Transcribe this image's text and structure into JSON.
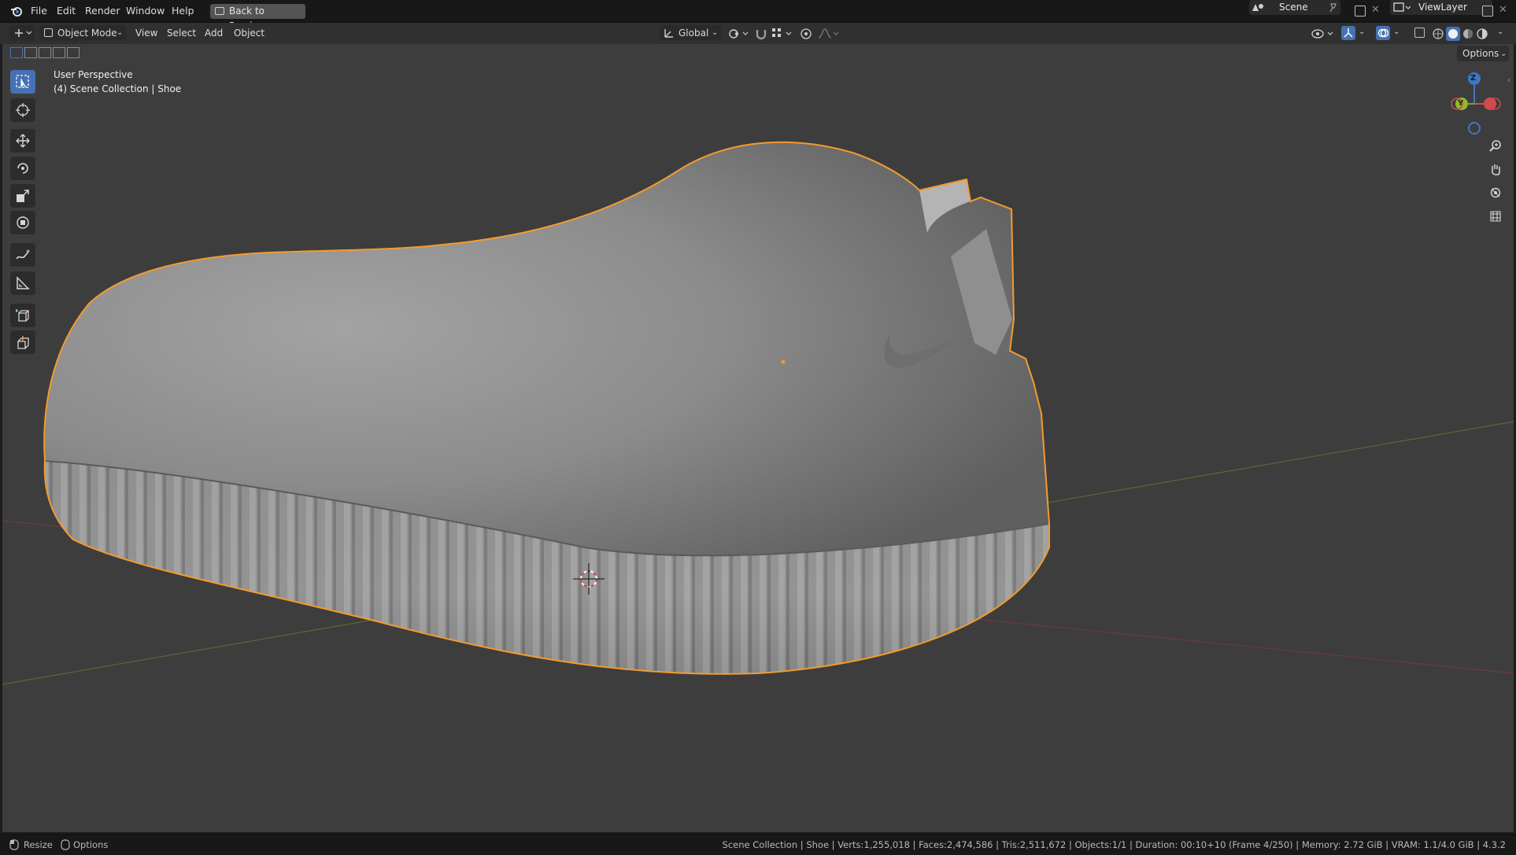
{
  "topbar": {
    "menu": [
      "File",
      "Edit",
      "Render",
      "Window",
      "Help"
    ],
    "back_button": "Back to Previous",
    "scene_name": "Scene",
    "view_layer": "ViewLayer"
  },
  "header": {
    "mode": "Object Mode",
    "menus": [
      "View",
      "Select",
      "Add",
      "Object"
    ],
    "orientation": "Global",
    "options_label": "Options"
  },
  "viewport": {
    "perspective": "User Perspective",
    "collection_info": "(4) Scene Collection | Shoe",
    "gizmo_axes": {
      "z": "Z",
      "y": "Y"
    },
    "colors": {
      "background": "#3d3d3d",
      "selection_outline": "#f39a2f",
      "x_axis": "#8a3a3a",
      "y_axis": "#5d7a2f",
      "active_tool": "#4671b5"
    }
  },
  "tools": [
    "select-box",
    "cursor",
    "move",
    "rotate",
    "scale",
    "transform",
    "annotate",
    "measure",
    "add-cube",
    "extrude"
  ],
  "statusbar": {
    "left_items": [
      "Resize",
      "Options"
    ],
    "info": "Scene Collection | Shoe | Verts:1,255,018 | Faces:2,474,586 | Tris:2,511,672 | Objects:1/1 | Duration: 00:10+10 (Frame 4/250) | Memory: 2.72 GiB | VRAM: 1.1/4.0 GiB | 4.3.2"
  }
}
